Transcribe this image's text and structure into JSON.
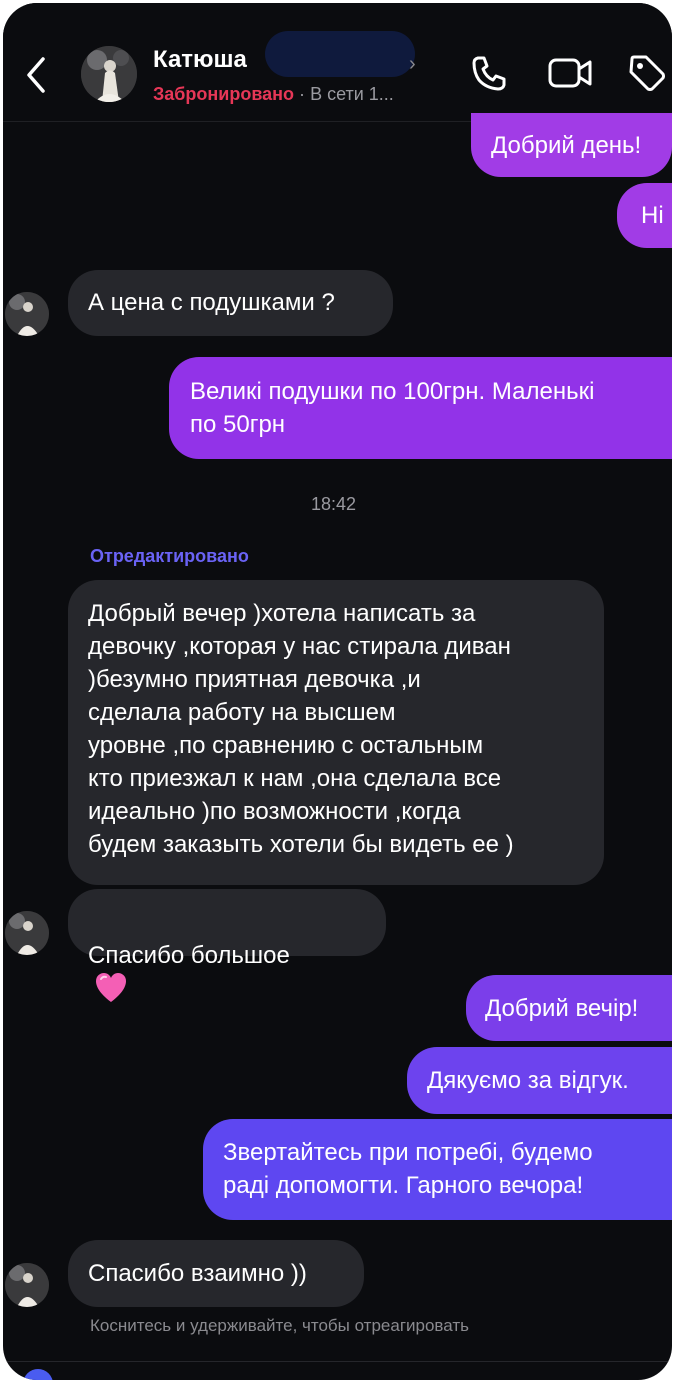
{
  "header": {
    "name": "Катюша",
    "status_label": "Забронировано",
    "separator": "·",
    "online_text": "В сети 1...",
    "chevron": "›"
  },
  "icons": {
    "back": "chevron-left-icon",
    "call": "phone-icon",
    "video": "video-camera-icon",
    "tag": "tag-icon"
  },
  "colors": {
    "background": "#0b0c0f",
    "incoming_bubble": "#26272c",
    "outgoing_purple": "#9a35e8",
    "outgoing_indigo": "#5e45f0",
    "status_red": "#e63757",
    "edited_label": "#6a63f5"
  },
  "messages": [
    {
      "dir": "out",
      "text": "Добрий день!"
    },
    {
      "dir": "out",
      "text": "Ні"
    },
    {
      "dir": "in",
      "text": "А цена с подушками ?"
    },
    {
      "dir": "out",
      "text": "Великі подушки по 100грн. Маленькі\nпо 50грн"
    },
    {
      "dir": "in",
      "text": "Добрый вечер )хотела написать за\nдевочку ,которая у нас стирала диван\n)безумно приятная девочка ,и\nсделала работу на высшем\nуровне ,по сравнению с остальным\nкто приезжал к нам  ,она сделала все\nидеально )по возможности ,когда\nбудем заказыть хотели бы видеть ее )"
    },
    {
      "dir": "in",
      "text": "Спасибо большое"
    },
    {
      "dir": "out",
      "text": "Добрий вечір!"
    },
    {
      "dir": "out",
      "text": "Дякуємо за відгук."
    },
    {
      "dir": "out",
      "text": "Звертайтесь при потребі,  будемо\nраді допомогти.  Гарного вечора!"
    },
    {
      "dir": "in",
      "text": "Спасибо взаимно ))"
    }
  ],
  "timestamp": "18:42",
  "edited_label": "Отредактировано",
  "reaction_hint": "Коснитесь и удерживайте, чтобы отреагировать"
}
